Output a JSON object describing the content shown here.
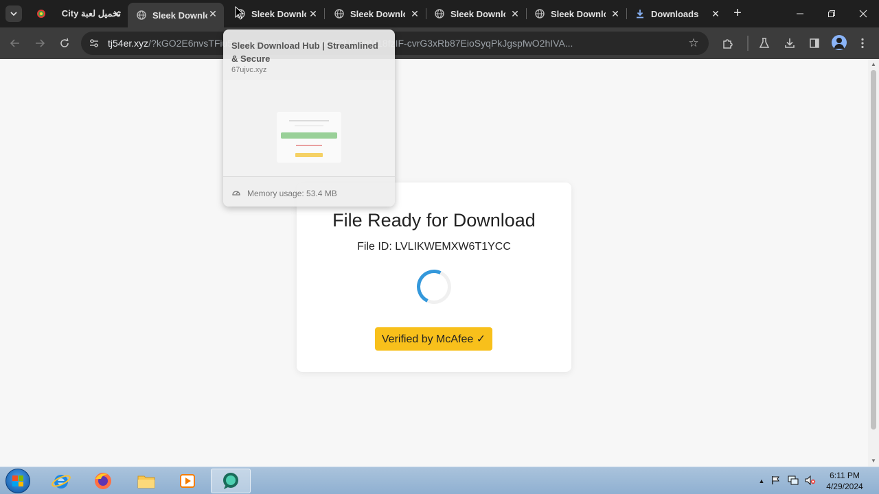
{
  "tabs": [
    {
      "title": "تحميل لعبة City",
      "favicon": "colorful-icon",
      "active": false
    },
    {
      "title": "Sleek Downlo",
      "favicon": "globe-icon",
      "active": true
    },
    {
      "title": "Sleek Downlo",
      "favicon": "globe-icon",
      "active": false
    },
    {
      "title": "Sleek Downlo",
      "favicon": "globe-icon",
      "active": false
    },
    {
      "title": "Sleek Downlo",
      "favicon": "globe-icon",
      "active": false
    },
    {
      "title": "Sleek Downlo",
      "favicon": "globe-icon",
      "active": false
    },
    {
      "title": "Downloads",
      "favicon": "download-icon",
      "active": false
    }
  ],
  "address_bar": {
    "host": "tj54er.xyz",
    "path": "/?kGO2E6nvsTFiu5...9QLQWJoV9YtnNwCE2U0hjsM18fzIF-cvrG3xRb87EioSyqPkJgspfwO2hIVA..."
  },
  "hover_card": {
    "title": "Sleek Download Hub | Streamlined & Secure",
    "domain": "67ujvc.xyz",
    "memory": "Memory usage: 53.4 MB"
  },
  "page": {
    "title": "File Ready for Download",
    "file_id": "File ID: LVLIKWEMXW6T1YCC",
    "verify_label": "Verified by McAfee ✓"
  },
  "taskbar": {
    "time": "6:11 PM",
    "date": "4/29/2024"
  },
  "colors": {
    "accent_yellow": "#f8c01b",
    "spinner_blue": "#3498db",
    "tab_strip": "#1f1f1f",
    "toolbar": "#3c3c3c"
  }
}
